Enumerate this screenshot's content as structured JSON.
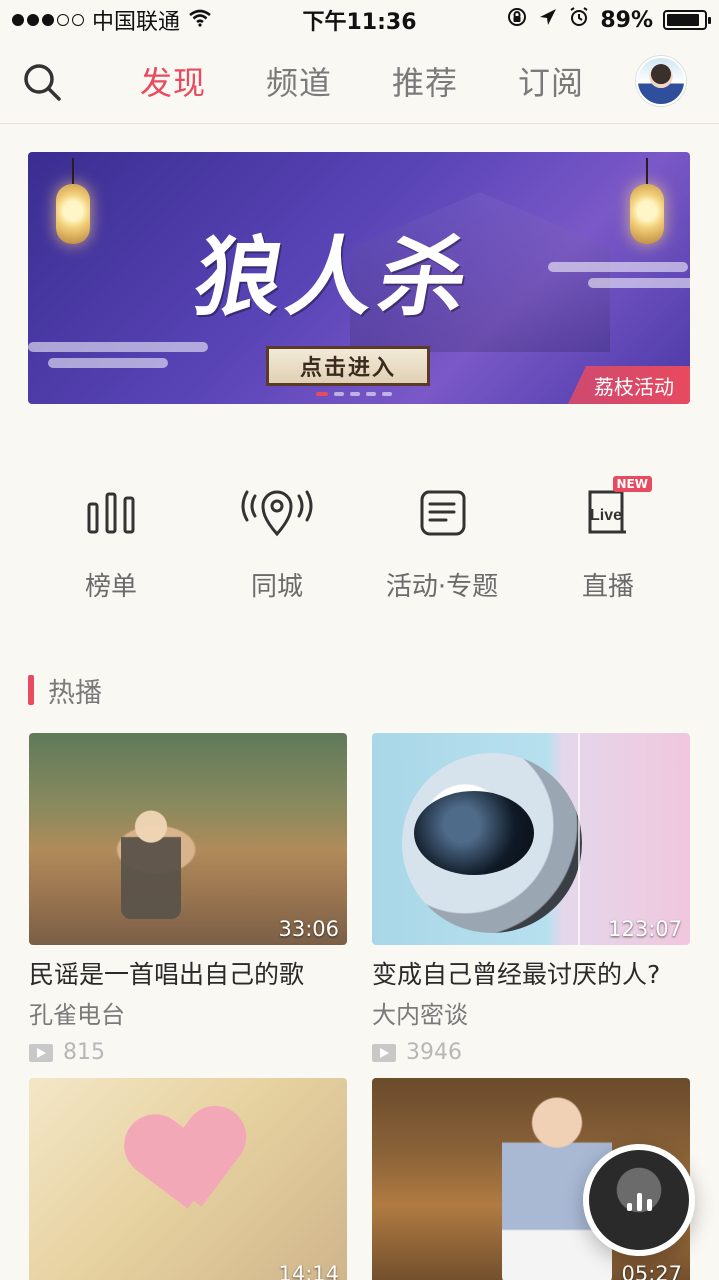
{
  "status_bar": {
    "carrier": "中国联通",
    "time": "下午11:36",
    "battery_percent": "89%",
    "battery_level": 0.89,
    "signal_bars_filled": 3,
    "signal_bars_total": 5
  },
  "nav": {
    "search_icon": "search-icon",
    "tabs": [
      {
        "label": "发现",
        "active": true
      },
      {
        "label": "频道",
        "active": false
      },
      {
        "label": "推荐",
        "active": false
      },
      {
        "label": "订阅",
        "active": false
      }
    ],
    "avatar_icon": "avatar"
  },
  "banner": {
    "title": "狼人杀",
    "button_label": "点击进入",
    "tag": "荔枝活动",
    "dots_total": 5,
    "dots_active_index": 0
  },
  "entries": [
    {
      "label": "榜单",
      "icon": "chart-bars-icon"
    },
    {
      "label": "同城",
      "icon": "location-pin-icon"
    },
    {
      "label": "活动·专题",
      "icon": "scroll-doc-icon"
    },
    {
      "label": "直播",
      "icon": "live-tv-icon",
      "icon_text": "Live",
      "badge": "NEW"
    }
  ],
  "section": {
    "title": "热播"
  },
  "cards": [
    {
      "title": "民谣是一首唱出自己的歌",
      "channel": "孔雀电台",
      "plays": "815",
      "duration": "33:06"
    },
    {
      "title": "变成自己曾经最讨厌的人?",
      "channel": "大内密谈",
      "plays": "3946",
      "duration": "123:07"
    },
    {
      "title": "",
      "channel": "",
      "plays": "",
      "duration": "14:14"
    },
    {
      "title": "",
      "channel": "",
      "plays": "",
      "duration": "05:27"
    }
  ],
  "colors": {
    "accent": "#e84a5f",
    "background": "#faf8f2",
    "text_muted": "#7a7a7a"
  }
}
